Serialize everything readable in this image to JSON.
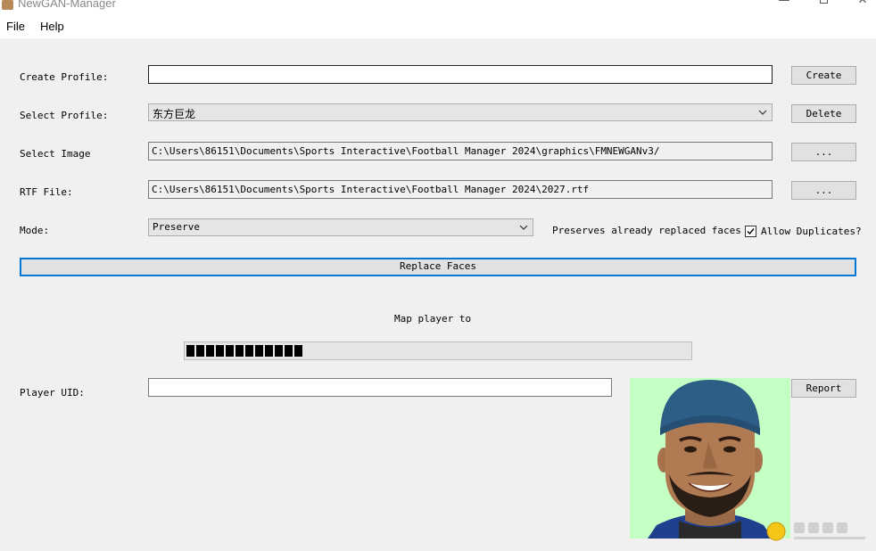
{
  "window": {
    "title": "NewGAN-Manager",
    "controls": {
      "minimize": "—",
      "close": "✕"
    }
  },
  "menu": {
    "file": "File",
    "help": "Help"
  },
  "create_profile": {
    "label": "Create Profile:",
    "value": "",
    "button": "Create"
  },
  "select_profile": {
    "label": "Select Profile:",
    "value": "东方巨龙",
    "button": "Delete"
  },
  "select_image": {
    "label": "Select Image",
    "value": "C:\\Users\\86151\\Documents\\Sports Interactive\\Football Manager 2024\\graphics\\FMNEWGANv3/",
    "button": "..."
  },
  "rtf_file": {
    "label": "RTF File:",
    "value": "C:\\Users\\86151\\Documents\\Sports Interactive\\Football Manager 2024\\2027.rtf",
    "button": "..."
  },
  "mode": {
    "label": "Mode:",
    "value": "Preserve",
    "description": "Preserves already replaced faces",
    "allow_duplicates": {
      "label": "Allow Duplicates?",
      "checked": true
    }
  },
  "replace_button": "Replace Faces",
  "status_text": "Map player to",
  "progress": {
    "segments": 12
  },
  "player_uid": {
    "label": "Player UID:",
    "value": "",
    "button": "Report"
  },
  "colors": {
    "photo_background": "#c4ffc4",
    "focus_blue": "#0078d7",
    "window_bg": "#f0f0f0"
  }
}
